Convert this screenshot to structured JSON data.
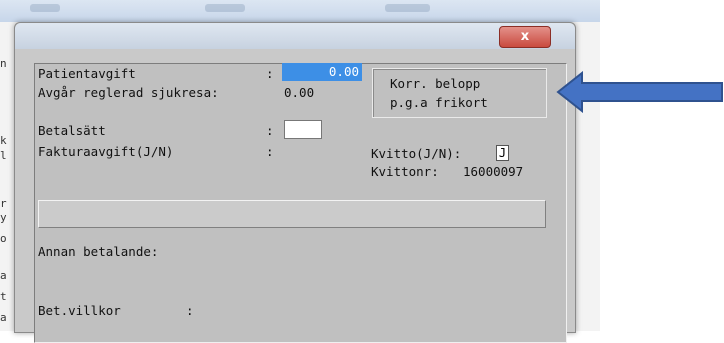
{
  "dialog": {
    "close_symbol": "x",
    "rows": {
      "patientavgift": {
        "label": "Patientavgift",
        "colon": ":",
        "value": "0.00"
      },
      "avgar": {
        "label": "Avgår reglerad sjukresa:",
        "value": "0.00"
      },
      "betalsatt": {
        "label": "Betalsätt",
        "colon": ":"
      },
      "fakturaavgift": {
        "label": "Fakturaavgift(J/N)",
        "colon": ":"
      },
      "kvitto": {
        "label": "Kvitto(J/N):",
        "value": "J"
      },
      "kvittonr": {
        "label": "Kvittonr:",
        "value": "16000097"
      },
      "annan": {
        "label": "Annan betalande:"
      },
      "betvillkor": {
        "label": "Bet.villkor",
        "colon": ":"
      }
    },
    "korr_box": {
      "line1": "Korr. belopp",
      "line2": "p.g.a frikort"
    }
  },
  "background": {
    "edge_letters": [
      "n",
      "k",
      "l",
      "r",
      "y",
      "o",
      "a",
      "t",
      "a"
    ]
  },
  "annotation": {
    "arrow_color": "#4472c4",
    "arrow_icon": "left-arrow-icon"
  }
}
